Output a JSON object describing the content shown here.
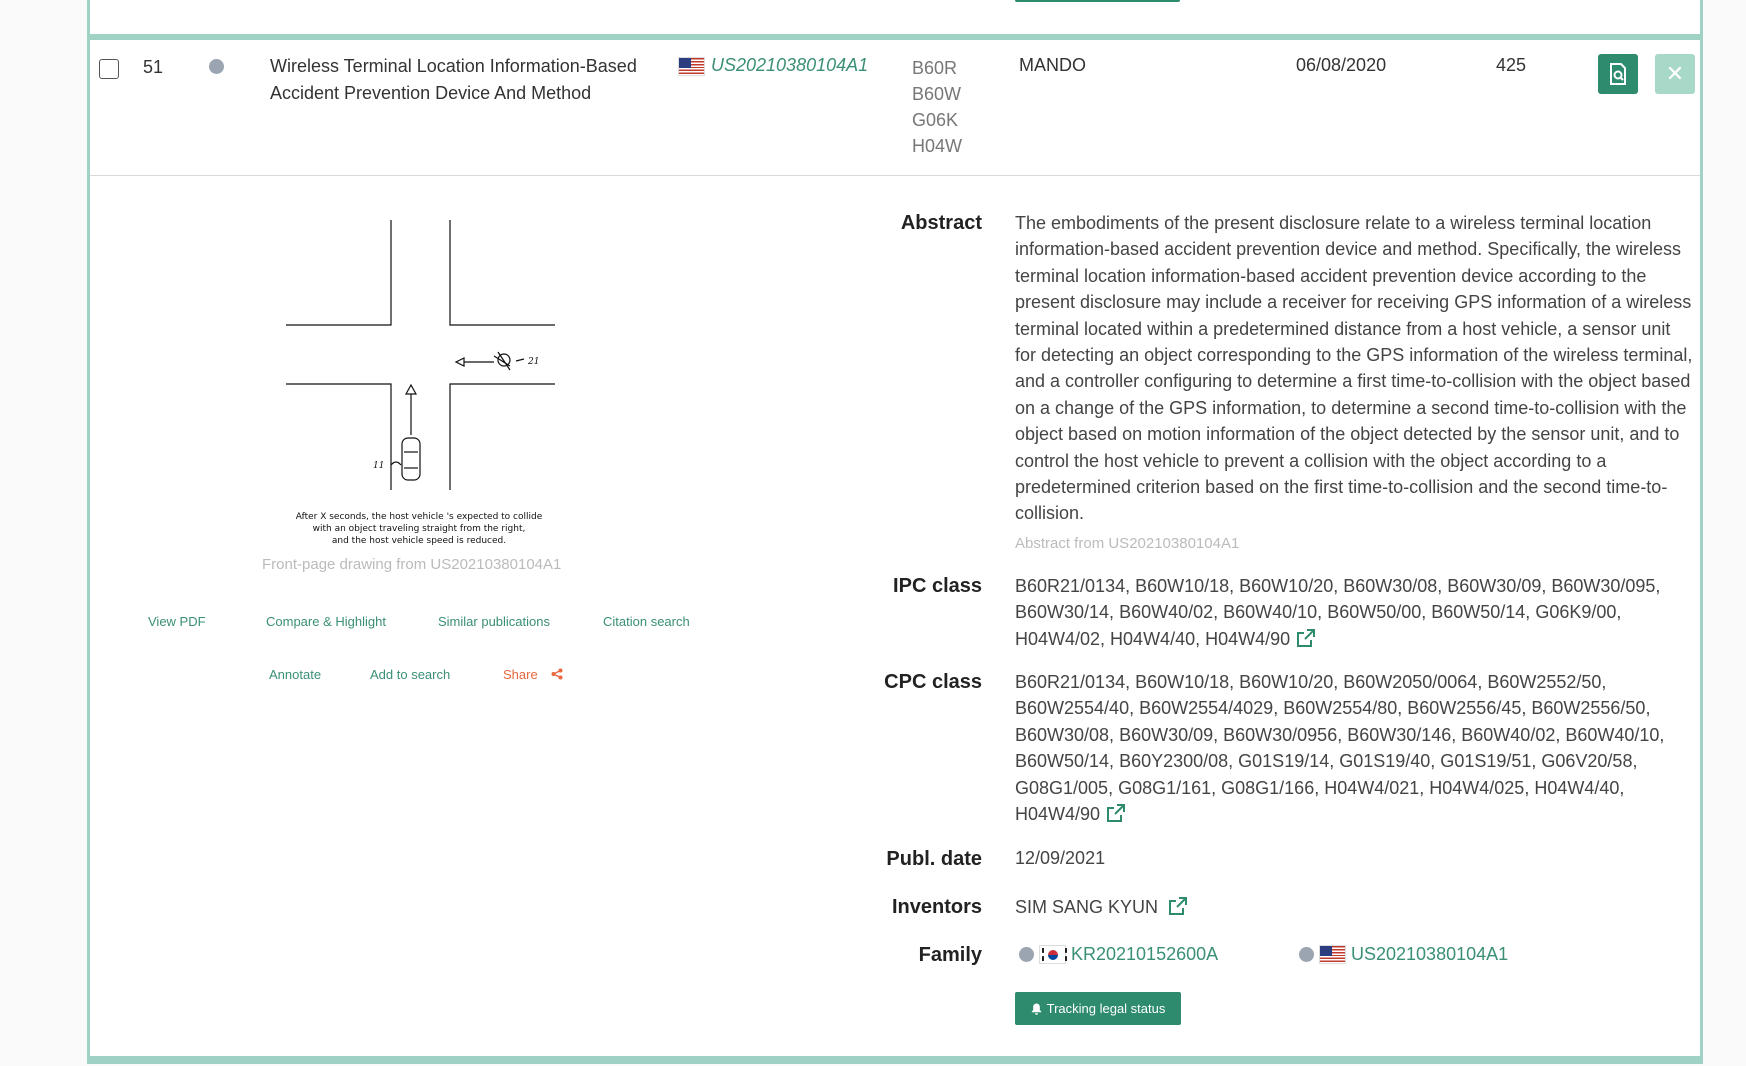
{
  "row": {
    "number": "51",
    "title": "Wireless Terminal Location Information-Based Accident Prevention Device And Method",
    "publication_number": "US20210380104A1",
    "ipc_codes": [
      "B60R",
      "B60W",
      "G06K",
      "H04W"
    ],
    "applicant": "MANDO",
    "priority_date": "06/08/2020",
    "count": "425"
  },
  "drawing": {
    "caption_line1": "After X seconds, the host vehicle 's expected to collide",
    "caption_line2": "with an object traveling straight from the right,",
    "caption_line3": "and the host vehicle speed is reduced.",
    "ref_21": "21",
    "ref_11": "11",
    "source": "Front-page drawing from US20210380104A1"
  },
  "actions": {
    "view_pdf": "View PDF",
    "compare": "Compare & Highlight",
    "similar": "Similar publications",
    "citation": "Citation search",
    "annotate": "Annotate",
    "add_to_search": "Add to search",
    "share": "Share"
  },
  "details": {
    "abstract_label": "Abstract",
    "abstract": "The embodiments of the present disclosure relate to a wireless terminal location information-based accident prevention device and method. Specifically, the wireless terminal location information-based accident prevention device according to the present disclosure may include a receiver for receiving GPS information of a wireless terminal located within a predetermined distance from a host vehicle, a sensor unit for detecting an object corresponding to the GPS information of the wireless terminal, and a controller configuring to determine a first time-to-collision with the object based on a change of the GPS information, to determine a second time-to-collision with the object based on motion information of the object detected by the sensor unit, and to control the host vehicle to prevent a collision with the object according to a predetermined criterion based on the first time-to-collision and the second time-to-collision.",
    "abstract_source": "Abstract from US20210380104A1",
    "ipc_label": "IPC class",
    "ipc_class": "B60R21/0134, B60W10/18, B60W10/20, B60W30/08, B60W30/09, B60W30/095, B60W30/14, B60W40/02, B60W40/10, B60W50/00, B60W50/14, G06K9/00, H04W4/02, H04W4/40, H04W4/90",
    "cpc_label": "CPC class",
    "cpc_class": "B60R21/0134, B60W10/18, B60W10/20, B60W2050/0064, B60W2552/50, B60W2554/40, B60W2554/4029, B60W2554/80, B60W2556/45, B60W2556/50, B60W30/08, B60W30/09, B60W30/0956, B60W30/146, B60W40/02, B60W40/10, B60W50/14, B60Y2300/08, G01S19/14, G01S19/40, G01S19/51, G06V20/58, G08G1/005, G08G1/161, G08G1/166, H04W4/021, H04W4/025, H04W4/40, H04W4/90",
    "publ_date_label": "Publ. date",
    "publ_date": "12/09/2021",
    "inventors_label": "Inventors",
    "inventors": "SIM SANG KYUN",
    "family_label": "Family",
    "family": [
      "KR20210152600A",
      "US20210380104A1"
    ],
    "tracking_button": "Tracking legal status"
  },
  "colors": {
    "accent": "#2e8b6e",
    "border": "#9fd2c4",
    "link": "#3a8f76",
    "share": "#e8673c"
  }
}
